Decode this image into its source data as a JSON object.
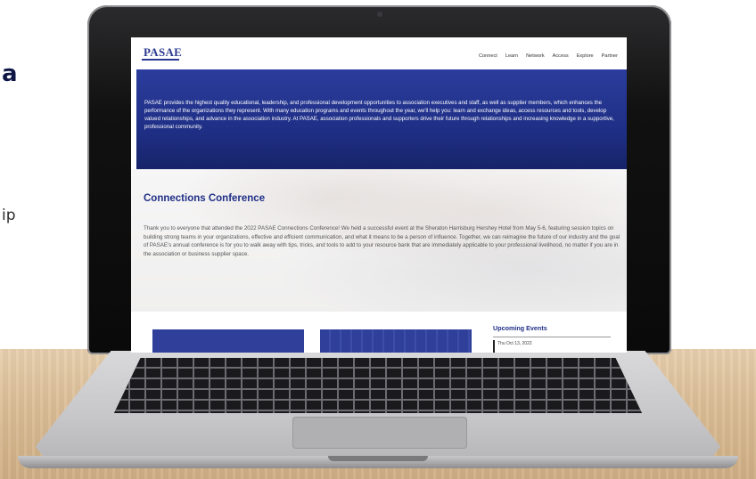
{
  "page": {
    "fragment_heading": "a",
    "fragment_text": "ip"
  },
  "site": {
    "logo": "PASAE",
    "nav": [
      "Connect",
      "Learn",
      "Network",
      "Access",
      "Explore",
      "Partner"
    ],
    "hero_text": "PASAE provides the highest quality educational, leadership, and professional development opportunities to association executives and staff, as well as supplier members, which enhances the performance of the organizations they represent. With many education programs and events throughout the year, we'll help you: learn and exchange ideas, access resources and tools, develop valued relationships, and advance in the association industry. At PASAE, association professionals and supporters drive their future through relationships and increasing knowledge in a supportive, professional community.",
    "conference": {
      "title": "Connections Conference",
      "body": "Thank you to everyone that attended the 2022 PASAE Connections Conference! We held a successful event at the Sheraton Harrisburg Hershey Hotel from May 5-6, featuring session topics on building strong teams in your organizations, effective and efficient communication, and what it means to be a person of influence. Together, we can reimagine the future of our industry and the goal of PASAE's annual conference is for you to walk away with tips, tricks, and tools to add to your resource bank that are immediately applicable to your professional livelihood, no matter if you are in the association or business supplier space."
    },
    "events": {
      "title": "Upcoming Events",
      "first_date": "Thu Oct 13, 2022"
    }
  },
  "colors": {
    "brand_blue": "#1f2f86",
    "hero_blue": "#2b3d9c",
    "laptop_bezel": "#111111",
    "table_wood": "#dcbf98"
  }
}
